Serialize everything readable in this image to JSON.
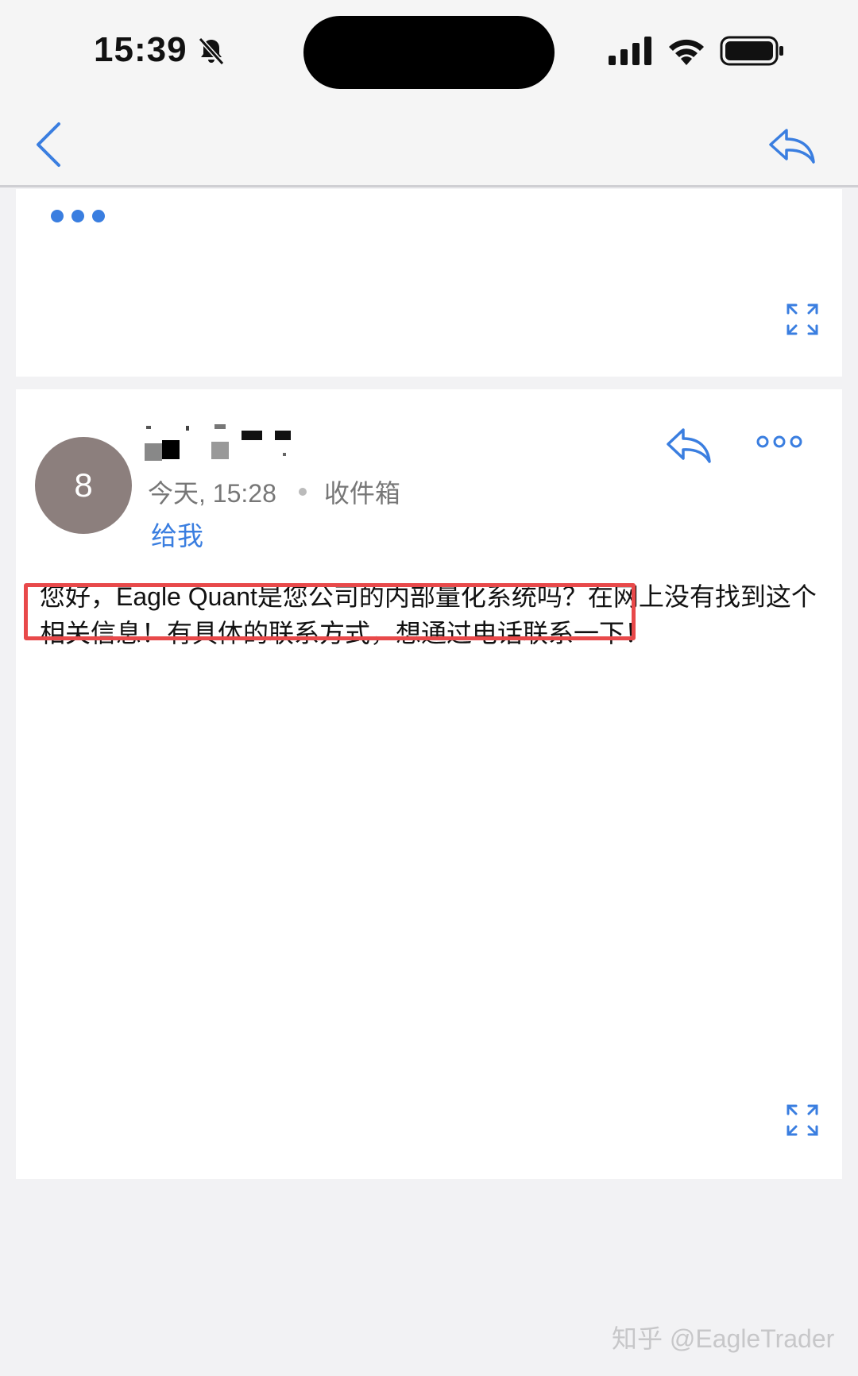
{
  "status_bar": {
    "time": "15:39"
  },
  "email": {
    "avatar_initial": "8",
    "date": "今天, 15:28",
    "folder": "收件箱",
    "recipient": "给我",
    "body": "您好，Eagle Quant是您公司的内部量化系统吗？在网上没有找到这个相关信息！有具体的联系方式，想通过电话联系一下！"
  },
  "watermark": "知乎 @EagleTrader",
  "colors": {
    "accent": "#3a7ee0",
    "highlight": "#e8494a",
    "avatar_bg": "#8c7f7d"
  }
}
